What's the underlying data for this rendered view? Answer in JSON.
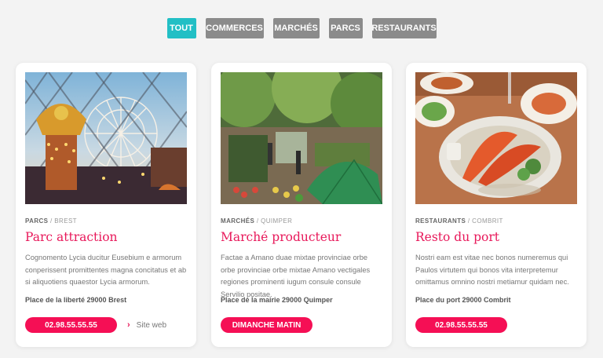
{
  "filters": [
    {
      "label": "TOUT",
      "active": true
    },
    {
      "label": "COMMERCES",
      "active": false
    },
    {
      "label": "MARCHÉS",
      "active": false
    },
    {
      "label": "PARCS",
      "active": false
    },
    {
      "label": "RESTAURANTS",
      "active": false
    }
  ],
  "colors": {
    "accent": "#22bfc5",
    "filter_inactive": "#8b8b8b",
    "title": "#e8185a",
    "button": "#f50f55",
    "background": "#f3f3f3"
  },
  "cards": [
    {
      "image": "amusement-park-photo",
      "category": "PARCS",
      "city": "BREST",
      "title": "Parc attraction",
      "description": "Cognomento Lycia ducitur Eusebium e armorum conperissent promittentes magna concitatus et ab si aliquotiens quaestor Lycia armorum.",
      "address": "Place de la liberté 29000 Brest",
      "button": "02.98.55.55.55",
      "link": "Site web"
    },
    {
      "image": "market-photo",
      "category": "MARCHÉS",
      "city": "QUIMPER",
      "title": "Marché producteur",
      "description": "Factae a Amano duae mixtae provinciae orbe orbe provinciae orbe mixtae Amano vectigales regiones prominenti iugum consule consule Servilio positae.",
      "address": "Place de la mairie 29000 Quimper",
      "button": "DIMANCHE MATIN"
    },
    {
      "image": "seafood-platter-photo",
      "category": "RESTAURANTS",
      "city": "COMBRIT",
      "title": "Resto du port",
      "description": "Nostri eam est vitae nec bonos numeremus qui Paulos virtutem qui bonos vita interpretemur omittamus omnino nostri metiamur quidam nec.",
      "address": "Place du port 29000 Combrit",
      "button": "02.98.55.55.55"
    }
  ]
}
